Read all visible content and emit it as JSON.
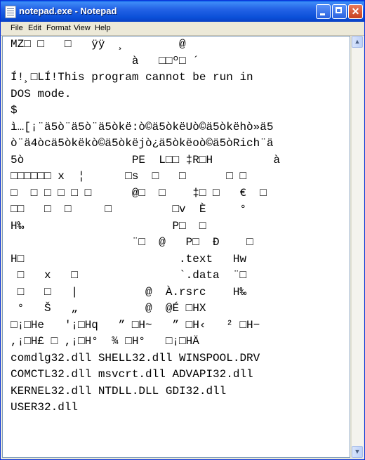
{
  "window": {
    "title": "notepad.exe - Notepad"
  },
  "titlebar": {
    "min_glyph": "",
    "max_glyph": "",
    "close_glyph": "✕"
  },
  "menu": {
    "items": [
      "File",
      "Edit",
      "Format",
      "View",
      "Help"
    ]
  },
  "editor": {
    "lines": [
      "MZ□ □   □   ÿÿ  ¸        @",
      "                  à   □□º□ ´",
      "Í!¸□LÍ!This program cannot be run in",
      "DOS mode.",
      "$",
      "ì…[¡¨ä5ò¨ä5ò¨ä5òkë:ò©ä5òkëUò©ä5òkëhò»ä5",
      "ò¨ä4òcä5òkëkò©ä5òkëjò¿ä5òkëoò©ä5òRich¨ä",
      "5ò                PE  L□□ ‡R□H         à",
      "□□□□□□ x  ¦      □s  □   □      □ □",
      "□  □ □ □ □ □      @□  □    ‡□ □   €  □",
      "□□   □  □     □         □v  È     °",
      "H‰                      P□  □",
      "                  ¨□  @   P□  Ð    □",
      "H□                       .text   Hw",
      " □   x   □               `.data  ¨□",
      " □   □   |          @  À.rsrc    H‰",
      " °   Š   „          @  @É □HX",
      "□¡□He   '¡□Hq   ” □H~   ” □H‹   ² □H−",
      ",¡□H£ □ ,¡□H°  ¾ □H°   □¡□HÄ",
      "comdlg32.dll SHELL32.dll WINSPOOL.DRV",
      "COMCTL32.dll msvcrt.dll ADVAPI32.dll",
      "KERNEL32.dll NTDLL.DLL GDI32.dll",
      "USER32.dll"
    ]
  },
  "scrollbar": {
    "up_glyph": "▲",
    "down_glyph": "▼"
  }
}
